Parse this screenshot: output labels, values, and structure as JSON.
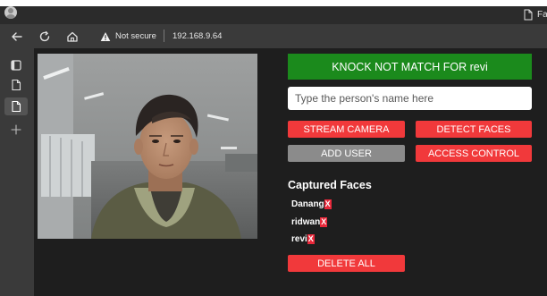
{
  "top_strip_text": "",
  "browser": {
    "tab_label": "Fa",
    "address": {
      "security_label": "Not secure",
      "url": "192.168.9.64"
    }
  },
  "page": {
    "status_banner": "KNOCK NOT MATCH FOR revi",
    "name_input": {
      "placeholder": "Type the person's name here",
      "value": ""
    },
    "buttons": {
      "stream_camera": "STREAM CAMERA",
      "detect_faces": "DETECT FACES",
      "add_user": "ADD USER",
      "access_control": "ACCESS CONTROL",
      "delete_all": "DELETE ALL"
    },
    "captured_faces": {
      "title": "Captured Faces",
      "remove_glyph": "X",
      "items": [
        {
          "name": "Danang"
        },
        {
          "name": "ridwan"
        },
        {
          "name": "revi"
        }
      ]
    }
  },
  "colors": {
    "banner_green": "#1b8a1c",
    "button_red": "#f1393b",
    "button_gray": "#8b8b8b",
    "page_background": "#1e1e1e",
    "browser_chrome": "#3a3a3a"
  }
}
